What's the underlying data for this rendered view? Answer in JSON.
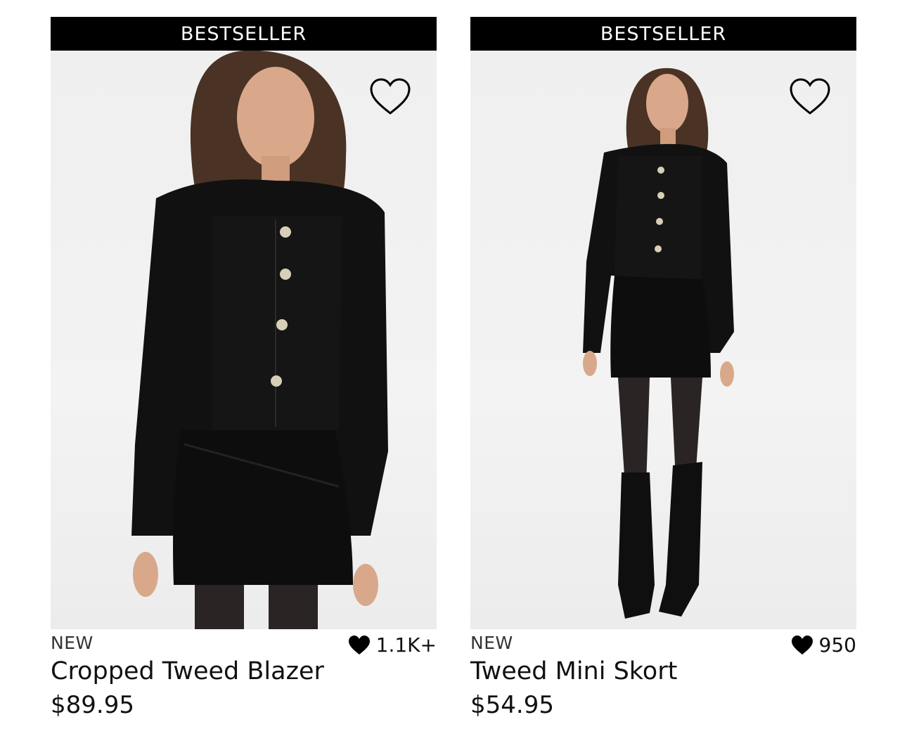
{
  "colors": {
    "badge_bg": "#000000",
    "badge_text": "#ffffff",
    "text": "#111111",
    "image_bg": "#efefef"
  },
  "products": [
    {
      "badge": "BESTSELLER",
      "tag": "NEW",
      "likes": "1.1K+",
      "title": "Cropped Tweed Blazer",
      "price": "$89.95",
      "wishlist_icon": "heart-outline-icon",
      "likes_icon": "heart-filled-icon"
    },
    {
      "badge": "BESTSELLER",
      "tag": "NEW",
      "likes": "950",
      "title": "Tweed Mini Skort",
      "price": "$54.95",
      "wishlist_icon": "heart-outline-icon",
      "likes_icon": "heart-filled-icon"
    }
  ]
}
